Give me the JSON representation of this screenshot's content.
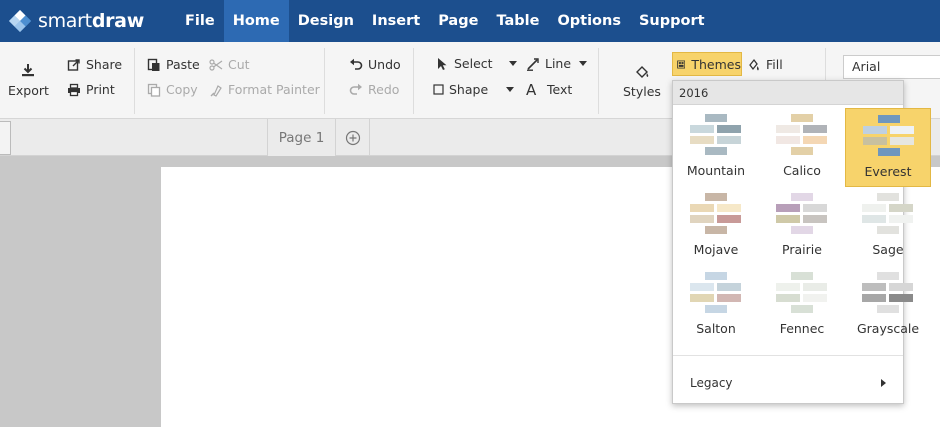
{
  "app": {
    "logo_text_light": "smart",
    "logo_text_bold": "draw"
  },
  "nav": [
    {
      "label": "File",
      "active": false
    },
    {
      "label": "Home",
      "active": true
    },
    {
      "label": "Design",
      "active": false
    },
    {
      "label": "Insert",
      "active": false
    },
    {
      "label": "Page",
      "active": false
    },
    {
      "label": "Table",
      "active": false
    },
    {
      "label": "Options",
      "active": false
    },
    {
      "label": "Support",
      "active": false
    }
  ],
  "ribbon": {
    "export": "Export",
    "share": "Share",
    "print": "Print",
    "paste": "Paste",
    "copy": "Copy",
    "cut": "Cut",
    "format_painter": "Format Painter",
    "undo": "Undo",
    "redo": "Redo",
    "select": "Select",
    "shape": "Shape",
    "line": "Line",
    "text": "Text",
    "styles": "Styles",
    "themes": "Themes",
    "fill": "Fill",
    "font": "Arial"
  },
  "pages": {
    "tab": "Page 1"
  },
  "themes_dropdown": {
    "header": "2016",
    "items": [
      {
        "name": "Mountain",
        "selected": false,
        "colors": [
          "#a9b9c2",
          "#c9d8dd",
          "#8fa3ad",
          "#e7dcc3",
          "#c7d4d8"
        ]
      },
      {
        "name": "Calico",
        "selected": false,
        "colors": [
          "#e3d0a7",
          "#efe9e4",
          "#b0b3b8",
          "#f1e7e3",
          "#f4d7b4"
        ]
      },
      {
        "name": "Everest",
        "selected": true,
        "colors": [
          "#6f97be",
          "#bfd0e1",
          "#eef2f6",
          "#c8c09f",
          "#e6e6e0"
        ]
      },
      {
        "name": "Mojave",
        "selected": false,
        "colors": [
          "#c8b6a6",
          "#ead8b5",
          "#f6e8c8",
          "#e0d4bf",
          "#c89a98"
        ]
      },
      {
        "name": "Prairie",
        "selected": false,
        "colors": [
          "#e2d7e6",
          "#b89fb9",
          "#d8d8d8",
          "#cfc9a8",
          "#c8c4c0"
        ]
      },
      {
        "name": "Sage",
        "selected": false,
        "colors": [
          "#e2e2de",
          "#eff1ee",
          "#d5d6c8",
          "#dfe6e6",
          "#f0f2f0"
        ]
      },
      {
        "name": "Salton",
        "selected": false,
        "colors": [
          "#c6d6e4",
          "#dbe6ee",
          "#c5d3db",
          "#e1d6b4",
          "#d2b7b3"
        ]
      },
      {
        "name": "Fennec",
        "selected": false,
        "colors": [
          "#d8e0d6",
          "#eef1ec",
          "#e9ece7",
          "#d7ddd1",
          "#f1f2ef"
        ]
      },
      {
        "name": "Grayscale",
        "selected": false,
        "colors": [
          "#e0e0e0",
          "#bdbdbd",
          "#d6d6d6",
          "#a7a7a7",
          "#8a8a8a"
        ]
      }
    ],
    "legacy": "Legacy"
  },
  "colors": {
    "nav_bg": "#1c4f8e",
    "nav_active": "#2d6ab3",
    "highlight": "#f7d36b"
  }
}
